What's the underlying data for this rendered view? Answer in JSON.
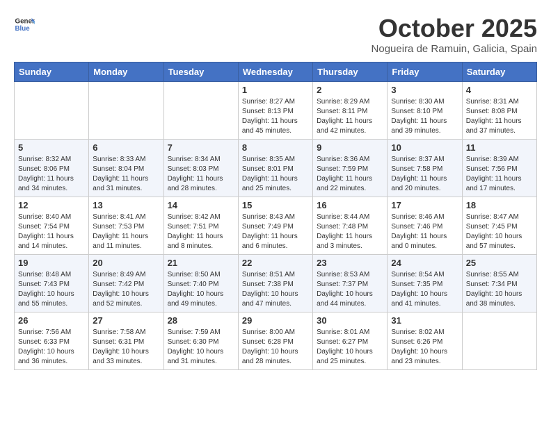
{
  "header": {
    "logo_general": "General",
    "logo_blue": "Blue",
    "month": "October 2025",
    "location": "Nogueira de Ramuin, Galicia, Spain"
  },
  "weekdays": [
    "Sunday",
    "Monday",
    "Tuesday",
    "Wednesday",
    "Thursday",
    "Friday",
    "Saturday"
  ],
  "weeks": [
    [
      {
        "day": "",
        "info": ""
      },
      {
        "day": "",
        "info": ""
      },
      {
        "day": "",
        "info": ""
      },
      {
        "day": "1",
        "info": "Sunrise: 8:27 AM\nSunset: 8:13 PM\nDaylight: 11 hours and 45 minutes."
      },
      {
        "day": "2",
        "info": "Sunrise: 8:29 AM\nSunset: 8:11 PM\nDaylight: 11 hours and 42 minutes."
      },
      {
        "day": "3",
        "info": "Sunrise: 8:30 AM\nSunset: 8:10 PM\nDaylight: 11 hours and 39 minutes."
      },
      {
        "day": "4",
        "info": "Sunrise: 8:31 AM\nSunset: 8:08 PM\nDaylight: 11 hours and 37 minutes."
      }
    ],
    [
      {
        "day": "5",
        "info": "Sunrise: 8:32 AM\nSunset: 8:06 PM\nDaylight: 11 hours and 34 minutes."
      },
      {
        "day": "6",
        "info": "Sunrise: 8:33 AM\nSunset: 8:04 PM\nDaylight: 11 hours and 31 minutes."
      },
      {
        "day": "7",
        "info": "Sunrise: 8:34 AM\nSunset: 8:03 PM\nDaylight: 11 hours and 28 minutes."
      },
      {
        "day": "8",
        "info": "Sunrise: 8:35 AM\nSunset: 8:01 PM\nDaylight: 11 hours and 25 minutes."
      },
      {
        "day": "9",
        "info": "Sunrise: 8:36 AM\nSunset: 7:59 PM\nDaylight: 11 hours and 22 minutes."
      },
      {
        "day": "10",
        "info": "Sunrise: 8:37 AM\nSunset: 7:58 PM\nDaylight: 11 hours and 20 minutes."
      },
      {
        "day": "11",
        "info": "Sunrise: 8:39 AM\nSunset: 7:56 PM\nDaylight: 11 hours and 17 minutes."
      }
    ],
    [
      {
        "day": "12",
        "info": "Sunrise: 8:40 AM\nSunset: 7:54 PM\nDaylight: 11 hours and 14 minutes."
      },
      {
        "day": "13",
        "info": "Sunrise: 8:41 AM\nSunset: 7:53 PM\nDaylight: 11 hours and 11 minutes."
      },
      {
        "day": "14",
        "info": "Sunrise: 8:42 AM\nSunset: 7:51 PM\nDaylight: 11 hours and 8 minutes."
      },
      {
        "day": "15",
        "info": "Sunrise: 8:43 AM\nSunset: 7:49 PM\nDaylight: 11 hours and 6 minutes."
      },
      {
        "day": "16",
        "info": "Sunrise: 8:44 AM\nSunset: 7:48 PM\nDaylight: 11 hours and 3 minutes."
      },
      {
        "day": "17",
        "info": "Sunrise: 8:46 AM\nSunset: 7:46 PM\nDaylight: 11 hours and 0 minutes."
      },
      {
        "day": "18",
        "info": "Sunrise: 8:47 AM\nSunset: 7:45 PM\nDaylight: 10 hours and 57 minutes."
      }
    ],
    [
      {
        "day": "19",
        "info": "Sunrise: 8:48 AM\nSunset: 7:43 PM\nDaylight: 10 hours and 55 minutes."
      },
      {
        "day": "20",
        "info": "Sunrise: 8:49 AM\nSunset: 7:42 PM\nDaylight: 10 hours and 52 minutes."
      },
      {
        "day": "21",
        "info": "Sunrise: 8:50 AM\nSunset: 7:40 PM\nDaylight: 10 hours and 49 minutes."
      },
      {
        "day": "22",
        "info": "Sunrise: 8:51 AM\nSunset: 7:38 PM\nDaylight: 10 hours and 47 minutes."
      },
      {
        "day": "23",
        "info": "Sunrise: 8:53 AM\nSunset: 7:37 PM\nDaylight: 10 hours and 44 minutes."
      },
      {
        "day": "24",
        "info": "Sunrise: 8:54 AM\nSunset: 7:35 PM\nDaylight: 10 hours and 41 minutes."
      },
      {
        "day": "25",
        "info": "Sunrise: 8:55 AM\nSunset: 7:34 PM\nDaylight: 10 hours and 38 minutes."
      }
    ],
    [
      {
        "day": "26",
        "info": "Sunrise: 7:56 AM\nSunset: 6:33 PM\nDaylight: 10 hours and 36 minutes."
      },
      {
        "day": "27",
        "info": "Sunrise: 7:58 AM\nSunset: 6:31 PM\nDaylight: 10 hours and 33 minutes."
      },
      {
        "day": "28",
        "info": "Sunrise: 7:59 AM\nSunset: 6:30 PM\nDaylight: 10 hours and 31 minutes."
      },
      {
        "day": "29",
        "info": "Sunrise: 8:00 AM\nSunset: 6:28 PM\nDaylight: 10 hours and 28 minutes."
      },
      {
        "day": "30",
        "info": "Sunrise: 8:01 AM\nSunset: 6:27 PM\nDaylight: 10 hours and 25 minutes."
      },
      {
        "day": "31",
        "info": "Sunrise: 8:02 AM\nSunset: 6:26 PM\nDaylight: 10 hours and 23 minutes."
      },
      {
        "day": "",
        "info": ""
      }
    ]
  ]
}
